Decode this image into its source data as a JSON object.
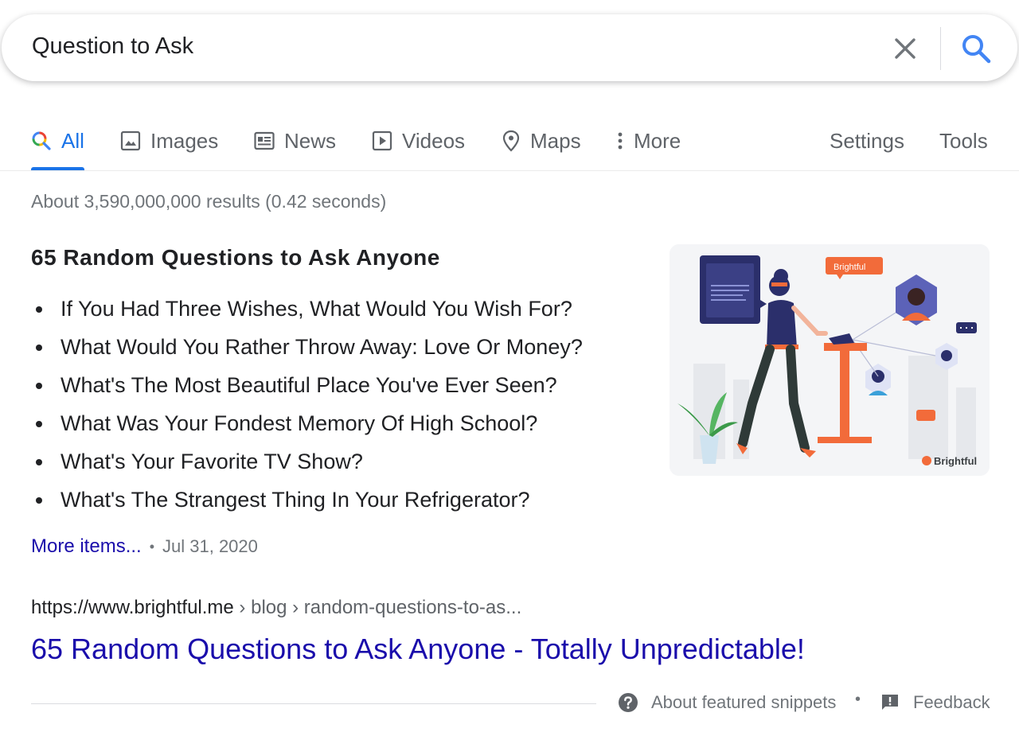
{
  "search": {
    "query": "Question to Ask",
    "clear_icon": "close-icon",
    "search_icon": "search-icon"
  },
  "tabs": [
    {
      "label": "All",
      "icon": "search-multicolor-icon",
      "active": true
    },
    {
      "label": "Images",
      "icon": "image-icon"
    },
    {
      "label": "News",
      "icon": "news-icon"
    },
    {
      "label": "Videos",
      "icon": "play-icon"
    },
    {
      "label": "Maps",
      "icon": "map-pin-icon"
    },
    {
      "label": "More",
      "icon": "more-vert-icon"
    },
    {
      "label": "Settings"
    },
    {
      "label": "Tools"
    }
  ],
  "results_stats": "About 3,590,000,000 results (0.42 seconds)",
  "snippet": {
    "title": "65 Random Questions to Ask Anyone",
    "items": [
      "If You Had Three Wishes, What Would You Wish For?",
      "What Would You Rather Throw Away: Love Or Money?",
      "What's The Most Beautiful Place You've Ever Seen?",
      "What Was Your Fondest Memory Of High School?",
      "What's Your Favorite TV Show?",
      "What's The Strangest Thing In Your Refrigerator?"
    ],
    "more_items": "More items...",
    "separator": "•",
    "date": "Jul 31, 2020",
    "image": {
      "brand_label": "Brightful",
      "badge_label": "Brightful"
    }
  },
  "result": {
    "url_host": "https://www.brightful.me",
    "url_path": " › blog › random-questions-to-as...",
    "title": "65 Random Questions to Ask Anyone - Totally Unpredictable!"
  },
  "footer": {
    "about_snippets": "About featured snippets",
    "separator": "•",
    "feedback": "Feedback"
  },
  "colors": {
    "accent_blue": "#1a73e8",
    "link_blue": "#1a0dab",
    "muted_gray": "#70757a",
    "illustration_orange": "#f26b3a",
    "illustration_navy": "#2b2f6b"
  }
}
